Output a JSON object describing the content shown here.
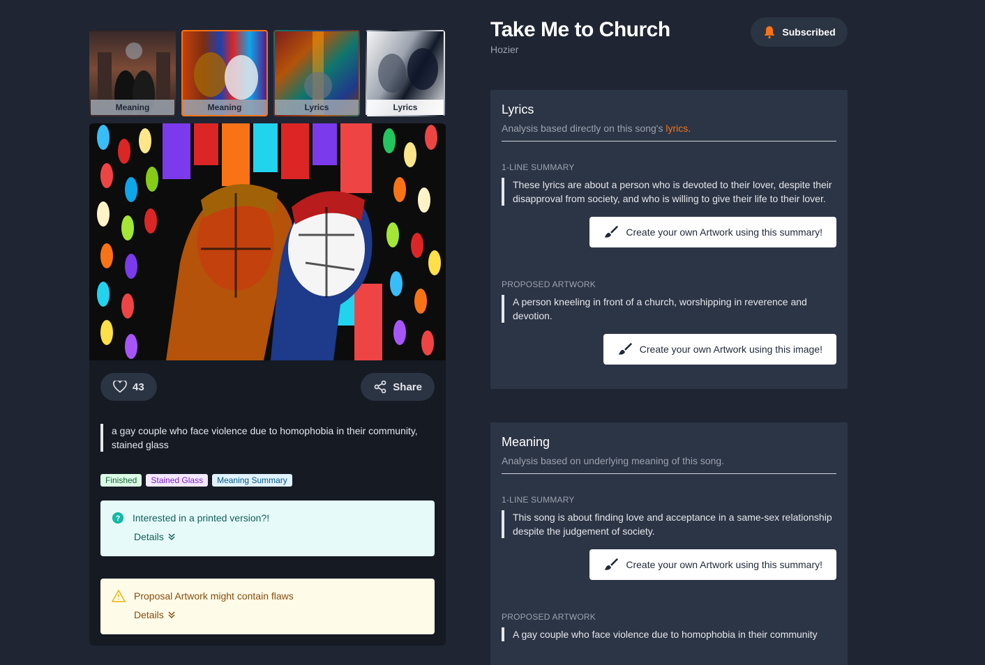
{
  "song": {
    "title": "Take Me to Church",
    "artist": "Hozier"
  },
  "subscribe": {
    "label": "Subscribed",
    "icon": "bell-icon"
  },
  "thumbnails": [
    {
      "label": "Meaning"
    },
    {
      "label": "Meaning"
    },
    {
      "label": "Lyrics"
    },
    {
      "label": "Lyrics"
    }
  ],
  "artwork": {
    "likes": "43",
    "share_label": "Share",
    "prompt": "a gay couple who face violence due to homophobia in their community, stained glass",
    "tags": [
      "Finished",
      "Stained Glass",
      "Meaning Summary"
    ]
  },
  "notices": {
    "print": {
      "title": "Interested in a printed version?!",
      "details": "Details"
    },
    "flaws": {
      "title": "Proposal Artwork might contain flaws",
      "details": "Details"
    }
  },
  "lyrics_panel": {
    "title": "Lyrics",
    "subtitle_prefix": "Analysis based directly on this song's",
    "subtitle_link": "lyrics",
    "subtitle_suffix": ".",
    "summary_label": "1-LINE SUMMARY",
    "summary": "These lyrics are about a person who is devoted to their lover, despite their disapproval from society, and who is willing to give their life to their lover.",
    "summary_button": "Create your own Artwork using this summary!",
    "artwork_label": "PROPOSED ARTWORK",
    "artwork": "A person kneeling in front of a church, worshipping in reverence and devotion.",
    "artwork_button": "Create your own Artwork using this image!"
  },
  "meaning_panel": {
    "title": "Meaning",
    "subtitle": "Analysis based on underlying meaning of this song.",
    "summary_label": "1-LINE SUMMARY",
    "summary": "This song is about finding love and acceptance in a same-sex relationship despite the judgement of society.",
    "summary_button": "Create your own Artwork using this summary!",
    "artwork_label": "PROPOSED ARTWORK",
    "artwork": "A gay couple who face violence due to homophobia in their community"
  },
  "colors": {
    "accent": "#f97316",
    "background": "#1f2532",
    "panel": "#2c3545"
  }
}
